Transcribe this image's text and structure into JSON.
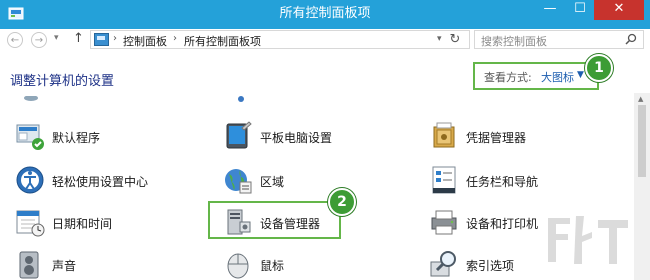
{
  "window": {
    "title": "所有控制面板项",
    "minimize_glyph": "—",
    "maximize_glyph": "☐",
    "close_glyph": "✕"
  },
  "nav": {
    "back_glyph": "←",
    "forward_glyph": "→",
    "up_glyph": "↑",
    "breadcrumb": [
      "控制面板",
      "所有控制面板项"
    ],
    "breadcrumb_sep": "›",
    "refresh_glyph": "↻",
    "search_placeholder": "搜索控制面板"
  },
  "header": {
    "title": "调整计算机的设置",
    "view_label": "查看方式:",
    "view_value": "大图标",
    "view_arrow": "▼"
  },
  "badges": [
    "1",
    "2"
  ],
  "items": {
    "default_programs": "默认程序",
    "tablet_settings": "平板电脑设置",
    "credential_manager": "凭据管理器",
    "ease_of_access": "轻松使用设置中心",
    "region": "区域",
    "taskbar_navigation": "任务栏和导航",
    "date_time": "日期和时间",
    "device_manager": "设备管理器",
    "devices_printers": "设备和打印机",
    "sound": "声音",
    "mouse": "鼠标",
    "indexing_options": "索引选项"
  },
  "colors": {
    "titlebar": "#24a1d9",
    "accent_green": "#64b649",
    "badge_green": "#3d9c35",
    "link_blue": "#1e3287",
    "close_red": "#c7332d"
  }
}
